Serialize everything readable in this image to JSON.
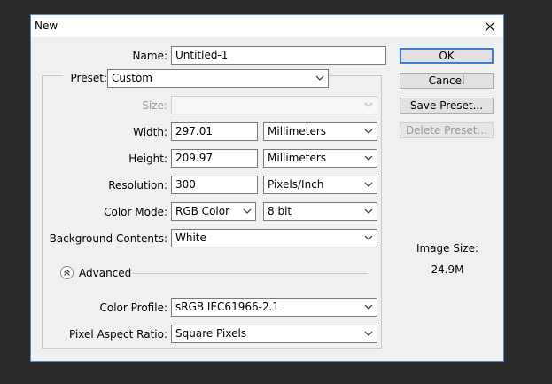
{
  "window": {
    "title": "New"
  },
  "name": {
    "label": "Name:",
    "value": "Untitled-1"
  },
  "preset": {
    "label": "Preset:",
    "value": "Custom"
  },
  "size": {
    "label": "Size:",
    "value": ""
  },
  "width": {
    "label": "Width:",
    "value": "297.01",
    "unit": "Millimeters"
  },
  "height": {
    "label": "Height:",
    "value": "209.97",
    "unit": "Millimeters"
  },
  "resolution": {
    "label": "Resolution:",
    "value": "300",
    "unit": "Pixels/Inch"
  },
  "color_mode": {
    "label": "Color Mode:",
    "value": "RGB Color",
    "depth": "8 bit"
  },
  "background": {
    "label": "Background Contents:",
    "value": "White"
  },
  "advanced": {
    "label": "Advanced"
  },
  "color_profile": {
    "label": "Color Profile:",
    "value": "sRGB IEC61966-2.1"
  },
  "pixel_aspect": {
    "label": "Pixel Aspect Ratio:",
    "value": "Square Pixels"
  },
  "buttons": {
    "ok": "OK",
    "cancel": "Cancel",
    "save_preset": "Save Preset...",
    "delete_preset": "Delete Preset..."
  },
  "image_size": {
    "label": "Image Size:",
    "value": "24.9M"
  },
  "colors": {
    "accent": "#3c7fd1",
    "background": "#2b2b2b",
    "dialog": "#f0f0f0"
  }
}
